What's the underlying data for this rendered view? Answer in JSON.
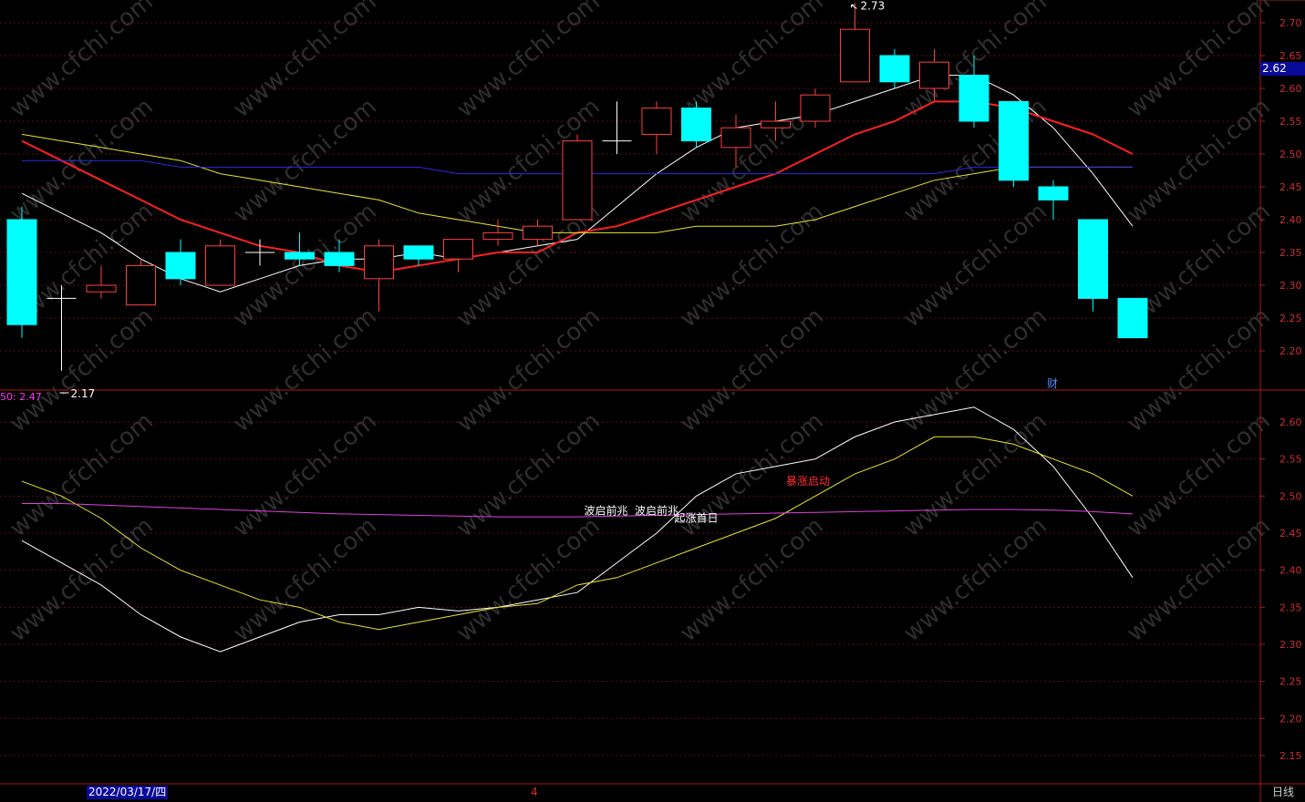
{
  "chart_data": [
    {
      "type": "candlestick",
      "panel": "price",
      "period": "日线",
      "date_label": "2022/03/17/四",
      "bottom_axis_marker": "4",
      "current_price_label": "2.62",
      "y_ticks": [
        "2.70",
        "2.65",
        "2.60",
        "2.55",
        "2.50",
        "2.45",
        "2.40",
        "2.35",
        "2.30",
        "2.25",
        "2.20"
      ],
      "ylim": [
        2.15,
        2.73
      ],
      "high_annotation": "2.73",
      "low_annotation": "2.17",
      "marker_text": "财",
      "candles": [
        {
          "o": 2.4,
          "h": 2.42,
          "l": 2.22,
          "c": 2.24
        },
        {
          "o": 2.28,
          "h": 2.3,
          "l": 2.17,
          "c": 2.28
        },
        {
          "o": 2.29,
          "h": 2.33,
          "l": 2.28,
          "c": 2.3
        },
        {
          "o": 2.27,
          "h": 2.34,
          "l": 2.27,
          "c": 2.33
        },
        {
          "o": 2.35,
          "h": 2.37,
          "l": 2.3,
          "c": 2.31
        },
        {
          "o": 2.3,
          "h": 2.37,
          "l": 2.3,
          "c": 2.36
        },
        {
          "o": 2.35,
          "h": 2.37,
          "l": 2.33,
          "c": 2.35
        },
        {
          "o": 2.35,
          "h": 2.38,
          "l": 2.33,
          "c": 2.34
        },
        {
          "o": 2.35,
          "h": 2.37,
          "l": 2.32,
          "c": 2.33
        },
        {
          "o": 2.31,
          "h": 2.37,
          "l": 2.26,
          "c": 2.36
        },
        {
          "o": 2.36,
          "h": 2.36,
          "l": 2.33,
          "c": 2.34
        },
        {
          "o": 2.34,
          "h": 2.37,
          "l": 2.32,
          "c": 2.37
        },
        {
          "o": 2.37,
          "h": 2.4,
          "l": 2.36,
          "c": 2.38
        },
        {
          "o": 2.37,
          "h": 2.4,
          "l": 2.36,
          "c": 2.39
        },
        {
          "o": 2.4,
          "h": 2.53,
          "l": 2.4,
          "c": 2.52
        },
        {
          "o": 2.52,
          "h": 2.58,
          "l": 2.5,
          "c": 2.52
        },
        {
          "o": 2.53,
          "h": 2.58,
          "l": 2.5,
          "c": 2.57
        },
        {
          "o": 2.57,
          "h": 2.58,
          "l": 2.51,
          "c": 2.52
        },
        {
          "o": 2.51,
          "h": 2.56,
          "l": 2.48,
          "c": 2.54
        },
        {
          "o": 2.54,
          "h": 2.58,
          "l": 2.52,
          "c": 2.55
        },
        {
          "o": 2.55,
          "h": 2.6,
          "l": 2.54,
          "c": 2.59
        },
        {
          "o": 2.61,
          "h": 2.73,
          "l": 2.61,
          "c": 2.69
        },
        {
          "o": 2.65,
          "h": 2.66,
          "l": 2.6,
          "c": 2.61
        },
        {
          "o": 2.6,
          "h": 2.66,
          "l": 2.58,
          "c": 2.64
        },
        {
          "o": 2.62,
          "h": 2.65,
          "l": 2.54,
          "c": 2.55
        },
        {
          "o": 2.58,
          "h": 2.58,
          "l": 2.45,
          "c": 2.46
        },
        {
          "o": 2.45,
          "h": 2.46,
          "l": 2.4,
          "c": 2.43
        },
        {
          "o": 2.4,
          "h": 2.4,
          "l": 2.26,
          "c": 2.28
        },
        {
          "o": 2.28,
          "h": 2.28,
          "l": 2.22,
          "c": 2.22
        }
      ],
      "series": [
        {
          "color": "#ffffff",
          "values": [
            2.44,
            2.41,
            2.38,
            2.34,
            2.31,
            2.29,
            2.31,
            2.33,
            2.34,
            2.34,
            2.35,
            2.34,
            2.35,
            2.36,
            2.37,
            2.42,
            2.47,
            2.51,
            2.54,
            2.55,
            2.56,
            2.58,
            2.6,
            2.62,
            2.62,
            2.59,
            2.54,
            2.47,
            2.39
          ]
        },
        {
          "color": "#ff2020",
          "values": [
            2.52,
            2.49,
            2.46,
            2.43,
            2.4,
            2.38,
            2.36,
            2.35,
            2.33,
            2.32,
            2.33,
            2.34,
            2.35,
            2.35,
            2.38,
            2.39,
            2.41,
            2.43,
            2.45,
            2.47,
            2.5,
            2.53,
            2.55,
            2.58,
            2.58,
            2.57,
            2.55,
            2.53,
            2.5
          ]
        },
        {
          "color": "#e6e62e",
          "values": [
            2.53,
            2.52,
            2.51,
            2.5,
            2.49,
            2.47,
            2.46,
            2.45,
            2.44,
            2.43,
            2.41,
            2.4,
            2.39,
            2.38,
            2.38,
            2.38,
            2.38,
            2.39,
            2.39,
            2.39,
            2.4,
            2.42,
            2.44,
            2.46,
            2.47,
            2.48,
            2.48,
            2.48,
            2.48
          ]
        },
        {
          "color": "#2a2ae6",
          "values": [
            2.49,
            2.49,
            2.49,
            2.49,
            2.48,
            2.48,
            2.48,
            2.48,
            2.48,
            2.48,
            2.48,
            2.47,
            2.47,
            2.47,
            2.47,
            2.47,
            2.47,
            2.47,
            2.47,
            2.47,
            2.47,
            2.47,
            2.47,
            2.47,
            2.48,
            2.48,
            2.48,
            2.48,
            2.48
          ]
        }
      ]
    },
    {
      "type": "line",
      "panel": "indicator",
      "legend_label": "50: 2.47",
      "y_ticks": [
        "2.60",
        "2.55",
        "2.50",
        "2.45",
        "2.40",
        "2.35",
        "2.30",
        "2.25",
        "2.20",
        "2.15"
      ],
      "ylim": [
        2.12,
        2.64
      ],
      "annotations": [
        {
          "text": "波启前兆",
          "color": "#ffffff",
          "index": 15,
          "value": 2.48
        },
        {
          "text": "波启前兆",
          "color": "#ffffff",
          "index": 16,
          "value": 2.48
        },
        {
          "text": "起涨首日",
          "color": "#ffffff",
          "index": 17,
          "value": 2.47
        },
        {
          "text": "暴涨启动",
          "color": "#ff3030",
          "index": 20,
          "value": 2.52
        }
      ],
      "series": [
        {
          "color": "#ffffff",
          "values": [
            2.44,
            2.41,
            2.38,
            2.34,
            2.31,
            2.29,
            2.31,
            2.33,
            2.34,
            2.34,
            2.35,
            2.345,
            2.35,
            2.36,
            2.37,
            2.41,
            2.45,
            2.5,
            2.53,
            2.54,
            2.55,
            2.58,
            2.6,
            2.61,
            2.62,
            2.59,
            2.54,
            2.47,
            2.39
          ]
        },
        {
          "color": "#e6e62e",
          "values": [
            2.52,
            2.5,
            2.47,
            2.43,
            2.4,
            2.38,
            2.36,
            2.35,
            2.33,
            2.32,
            2.33,
            2.34,
            2.35,
            2.355,
            2.38,
            2.39,
            2.41,
            2.43,
            2.45,
            2.47,
            2.5,
            2.53,
            2.55,
            2.58,
            2.58,
            2.57,
            2.55,
            2.53,
            2.5
          ]
        },
        {
          "color": "#e040e0",
          "values": [
            2.49,
            2.49,
            2.488,
            2.486,
            2.484,
            2.482,
            2.48,
            2.478,
            2.476,
            2.475,
            2.474,
            2.473,
            2.472,
            2.472,
            2.472,
            2.473,
            2.474,
            2.475,
            2.476,
            2.477,
            2.478,
            2.479,
            2.48,
            2.481,
            2.482,
            2.482,
            2.481,
            2.479,
            2.476
          ]
        }
      ]
    }
  ]
}
